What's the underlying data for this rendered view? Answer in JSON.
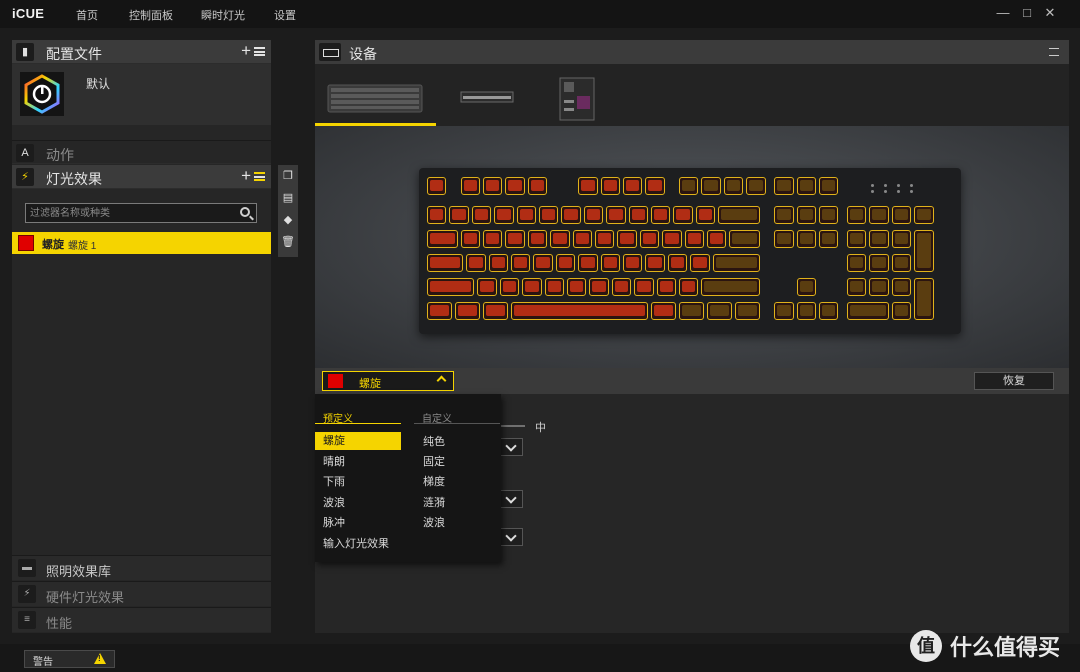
{
  "app": {
    "logo": "iCUE"
  },
  "nav": {
    "items": [
      "首页",
      "控制面板",
      "瞬时灯光",
      "设置"
    ]
  },
  "window_controls": {
    "minimize": "—",
    "maximize": "□",
    "close": "✕"
  },
  "profiles": {
    "title": "配置文件",
    "add": "+",
    "current_name": "默认"
  },
  "actions": {
    "title": "动作",
    "icon": "A"
  },
  "lighting": {
    "title": "灯光效果",
    "add": "+",
    "filter_placeholder": "过滤器名称或种类",
    "selected_effect": {
      "name": "螺旋",
      "sub": "螺旋 1",
      "color": "#e00000"
    }
  },
  "library": {
    "items": [
      {
        "label": "照明效果库",
        "icon": "folder-icon"
      },
      {
        "label": "硬件灯光效果",
        "icon": "lightning-icon"
      },
      {
        "label": "性能",
        "icon": "sliders-icon"
      }
    ]
  },
  "devices": {
    "title": "设备",
    "tabs": [
      "keyboard",
      "memory",
      "motherboard"
    ]
  },
  "effect_bar": {
    "selected": "螺旋",
    "restore": "恢复"
  },
  "settings": {
    "speed_mid_label": "中"
  },
  "dropdown": {
    "predefined_title": "预定义",
    "custom_title": "自定义",
    "predefined": [
      "螺旋",
      "晴朗",
      "下雨",
      "波浪",
      "脉冲",
      "输入灯光效果"
    ],
    "custom": [
      "纯色",
      "固定",
      "梯度",
      "涟漪",
      "波浪"
    ]
  },
  "status": {
    "warning": "警告"
  },
  "watermark": {
    "circle": "值",
    "text": "什么值得买"
  },
  "colors": {
    "accent": "#f5d400",
    "effect_red": "#e00000",
    "key_glow": "#b12d14"
  }
}
